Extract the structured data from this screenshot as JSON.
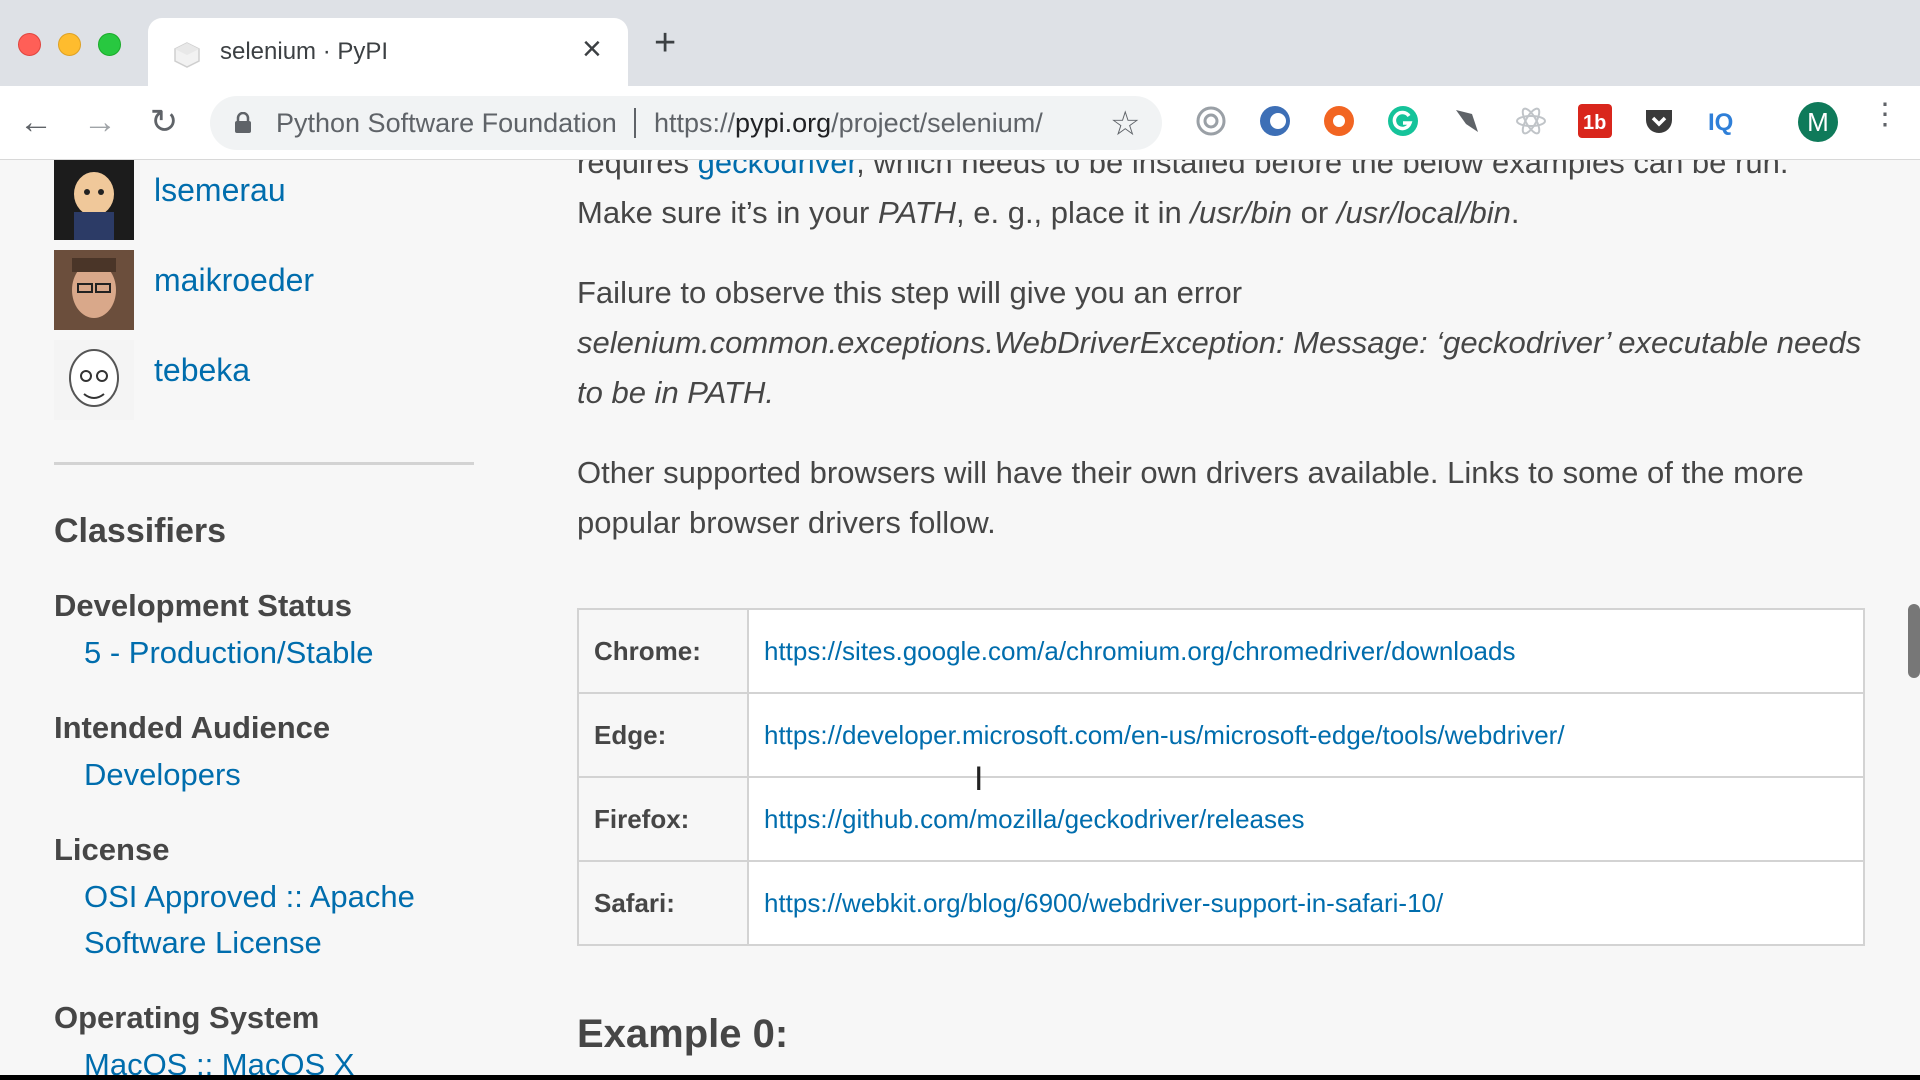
{
  "browser": {
    "tab_title": "selenium · PyPI",
    "tab_close": "×",
    "new_tab": "+",
    "back": "←",
    "forward": "→",
    "reload": "↻",
    "site_name": "Python Software Foundation",
    "url_prefix": "https://",
    "url_host": "pypi.org",
    "url_path": "/project/selenium/",
    "star": "☆",
    "profile_initial": "M",
    "menu": "⋮"
  },
  "sidebar": {
    "maintainers": [
      {
        "name": "lsemerau"
      },
      {
        "name": "maikroeder"
      },
      {
        "name": "tebeka"
      }
    ],
    "classifiers_title": "Classifiers",
    "groups": [
      {
        "heading": "Development Status",
        "items": [
          "5 - Production/Stable"
        ]
      },
      {
        "heading": "Intended Audience",
        "items": [
          "Developers"
        ]
      },
      {
        "heading": "License",
        "items": [
          "OSI Approved :: Apache",
          "Software License"
        ]
      },
      {
        "heading": "Operating System",
        "items": [
          "MacOS :: MacOS X"
        ]
      }
    ]
  },
  "main": {
    "p1_requires": "requires ",
    "p1_link": "geckodriver",
    "p1_rest": ", which needs to be installed before the below examples can be run.",
    "p2_a": "Make sure it’s in your ",
    "p2_path": "PATH",
    "p2_b": ", e. g., place it in ",
    "p2_bin": "/usr/bin",
    "p2_c": " or ",
    "p2_local": "/usr/local/bin",
    "p2_d": ".",
    "p3_a": "Failure to observe this step will give you an error",
    "p3_err": "selenium.common.exceptions.WebDriverException: Message: ‘geckodriver’ executable needs to be in PATH.",
    "p4": "Other supported browsers will have their own drivers available. Links to some of the more popular browser drivers follow.",
    "drivers": [
      {
        "browser": "Chrome:",
        "url": "https://sites.google.com/a/chromium.org/chromedriver/downloads"
      },
      {
        "browser": "Edge:",
        "url": "https://developer.microsoft.com/en-us/microsoft-edge/tools/webdriver/"
      },
      {
        "browser": "Firefox:",
        "url": "https://github.com/mozilla/geckodriver/releases"
      },
      {
        "browser": "Safari:",
        "url": "https://webkit.org/blog/6900/webdriver-support-in-safari-10/"
      }
    ],
    "example_heading": "Example 0:"
  }
}
